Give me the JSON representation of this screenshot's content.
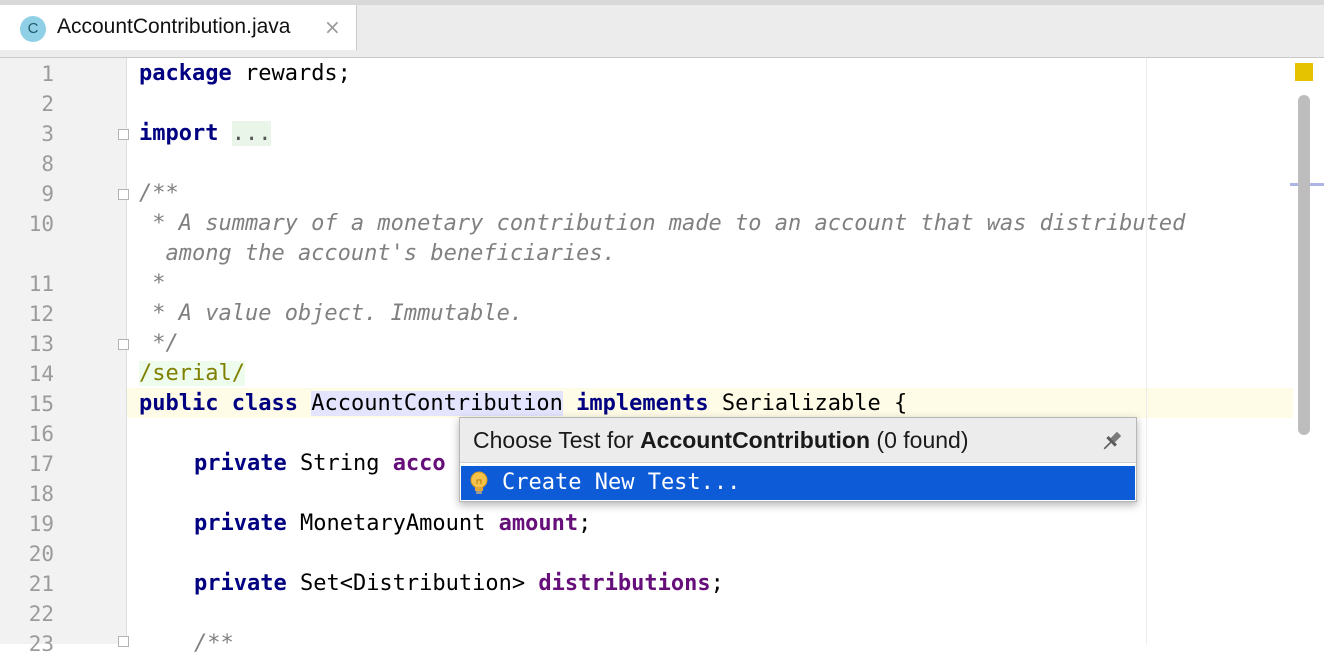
{
  "tab": {
    "badge": "C",
    "title": "AccountContribution.java",
    "close": "×"
  },
  "gutter": {
    "line_numbers": [
      "1",
      "2",
      "3",
      "8",
      "9",
      "10",
      "",
      "11",
      "12",
      "13",
      "14",
      "15",
      "16",
      "17",
      "18",
      "19",
      "20",
      "21",
      "22",
      "23"
    ]
  },
  "code": {
    "l1_kw": "package",
    "l1_rest": " rewards;",
    "l3_kw": "import",
    "l3_dots": "...",
    "l9": "/**",
    "l10a": " * A summary of a monetary contribution made to an account that was distributed",
    "l10b": "  among the account's beneficiaries.",
    "l11": " *",
    "l12": " * A value object. Immutable.",
    "l13": " */",
    "l14": "/serial/",
    "l15_kw1": "public",
    "l15_kw2": "class",
    "l15_name": "AccountContribution",
    "l15_kw3": "implements",
    "l15_rest": " Serializable {",
    "l17_kw": "private",
    "l17_type": " String ",
    "l17_field": "acco",
    "l19_kw": "private",
    "l19_type": " MonetaryAmount ",
    "l19_field": "amount",
    "l19_end": ";",
    "l21_kw": "private",
    "l21_type": " Set<Distribution> ",
    "l21_field": "distributions",
    "l21_end": ";",
    "l23": "/**"
  },
  "popup": {
    "title_prefix": "Choose Test for ",
    "title_class": "AccountContribution",
    "title_suffix": " (0 found)",
    "item_label": "Create New Test...",
    "pin_icon": "pin-icon",
    "item_icon": "lightbulb-icon"
  },
  "colors": {
    "keyword": "#000080",
    "field": "#660e7a",
    "comment": "#808080",
    "selection": "#0e5bd7",
    "current_line": "#fefbe6"
  }
}
